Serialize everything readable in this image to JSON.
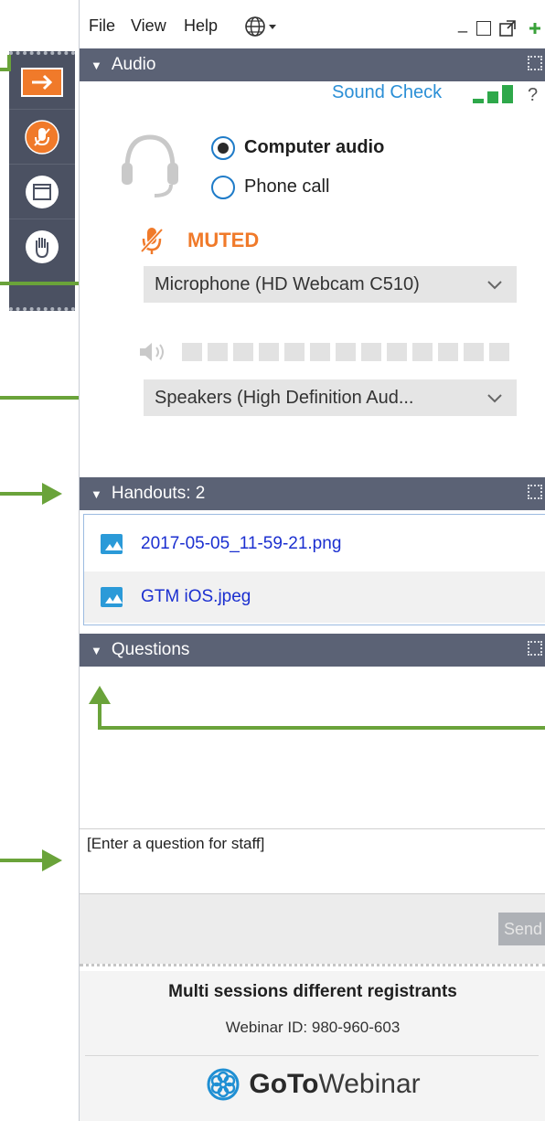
{
  "menu": {
    "file": "File",
    "view": "View",
    "help": "Help",
    "minimize": "_"
  },
  "audio": {
    "section_title": "Audio",
    "sound_check": "Sound Check",
    "help": "?",
    "options": [
      "Computer audio",
      "Phone call"
    ],
    "selected_option": "Computer audio",
    "muted": "MUTED",
    "microphone": "Microphone (HD Webcam C510)",
    "speakers": "Speakers (High Definition Aud...",
    "speaker_level_segments": 13
  },
  "handouts": {
    "section_title": "Handouts: 2",
    "files": [
      "2017-05-05_11-59-21.png",
      "GTM iOS.jpeg"
    ]
  },
  "questions": {
    "section_title": "Questions",
    "placeholder": "[Enter a question for staff]",
    "send": "Send"
  },
  "footer": {
    "session_name": "Multi sessions different registrants",
    "webinar_id": "Webinar ID: 980-960-603",
    "logo_goto": "GoTo",
    "logo_webinar": "Webinar"
  },
  "colors": {
    "section_header": "#5b6275",
    "accent_orange": "#f07a2a",
    "link_blue": "#2b8fd6",
    "annotation_green": "#6aa33a"
  }
}
